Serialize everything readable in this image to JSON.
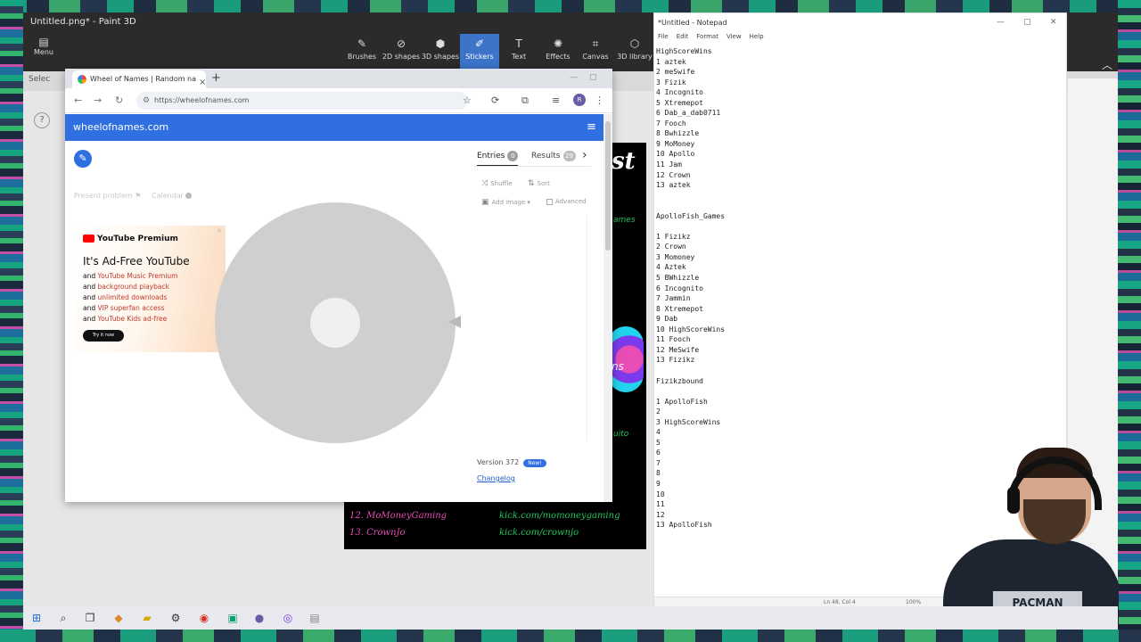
{
  "paint3d": {
    "title": "Untitled.png* - Paint 3D",
    "menu_label": "Menu",
    "tools": [
      {
        "label": "Brushes",
        "icon": "brush-icon"
      },
      {
        "label": "2D shapes",
        "icon": "2d-shapes-icon"
      },
      {
        "label": "3D shapes",
        "icon": "3d-shapes-icon"
      },
      {
        "label": "Stickers",
        "icon": "stickers-icon",
        "active": true
      },
      {
        "label": "Text",
        "icon": "text-icon"
      },
      {
        "label": "Effects",
        "icon": "effects-icon"
      },
      {
        "label": "Canvas",
        "icon": "canvas-icon"
      },
      {
        "label": "3D library",
        "icon": "3d-library-icon"
      }
    ],
    "select_label": "Selec"
  },
  "overlay": {
    "title": "st",
    "fragments": [
      "ames",
      "uito",
      "ns"
    ],
    "rows": [
      {
        "name": "12. MoMoneyGaming",
        "link": "kick.com/momoneygaming"
      },
      {
        "name": "13. CrownJo",
        "link": "kick.com/crownjo"
      }
    ]
  },
  "chrome": {
    "tab_title": "Wheel of Names | Random na",
    "url": "https://wheelofnames.com",
    "avatar_letter": "R"
  },
  "wheelofnames": {
    "brand": "wheelofnames.com",
    "left_faint_1": "Present problem",
    "left_faint_2": "Calendar",
    "tabs": {
      "entries_label": "Entries",
      "entries_count": "0",
      "results_label": "Results",
      "results_count": "29"
    },
    "options": {
      "shuffle": "Shuffle",
      "sort": "Sort",
      "add_image": "Add image",
      "advanced": "Advanced"
    },
    "version": "Version 372",
    "new_badge": "New!",
    "changelog": "Changelog"
  },
  "ad": {
    "brand": "YouTube Premium",
    "headline": "It's Ad-Free YouTube",
    "lines": [
      {
        "pre": "and ",
        "hl": "YouTube Music Premium"
      },
      {
        "pre": "and ",
        "hl": "background playback"
      },
      {
        "pre": "and ",
        "hl": "unlimited downloads"
      },
      {
        "pre": "and ",
        "hl": "VIP superfan access"
      },
      {
        "pre": "and ",
        "hl": "YouTube Kids ad-free"
      }
    ],
    "button": "Try it now"
  },
  "notepad": {
    "title": "*Untitled - Notepad",
    "menu": [
      "File",
      "Edit",
      "Format",
      "View",
      "Help"
    ],
    "content": "HighScoreWins\n1 aztek\n2 meSwife\n3 Fizik\n4 Incognito\n5 Xtremepot\n6 Dab_a_dab0711\n7 Fooch\n8 Bwhizzle\n9 MoMoney\n10 Apollo\n11 Jam\n12 Crown\n13 aztek\n\n\nApolloFish_Games\n\n1 Fizikz\n2 Crown\n3 Momoney\n4 Aztek\n5 BWhizzle\n6 Incognito\n7 Jammin\n8 Xtremepot\n9 Dab\n10 HighScoreWins\n11 Fooch\n12 MeSwife\n13 Fizikz\n\nFizikzbound\n\n1 ApolloFish\n2\n3 HighScoreWins\n4\n5\n6\n7\n8\n9\n10\n11\n12\n13 ApolloFish",
    "status_position": "Ln 48, Col 4",
    "status_zoom": "100%"
  },
  "webcam": {
    "shirt_text": "PACMAN"
  },
  "colors": {
    "won_blue": "#2f6fe0",
    "overlay_pink": "#e84db5",
    "overlay_green": "#22c55e",
    "paint_accent": "#3b74c9"
  }
}
